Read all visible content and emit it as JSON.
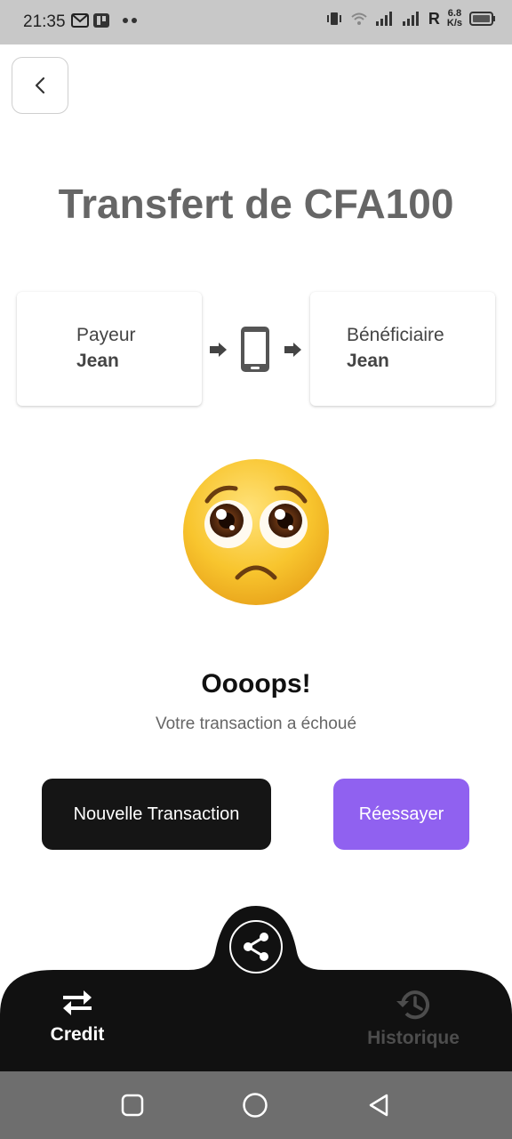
{
  "status_bar": {
    "time": "21:35",
    "network_speed_value": "6.8",
    "network_speed_unit": "K/s",
    "roaming_label": "R"
  },
  "page": {
    "title": "Transfert de CFA100"
  },
  "payer": {
    "role": "Payeur",
    "name": "Jean"
  },
  "beneficiary": {
    "role": "Bénéficiaire",
    "name": "Jean"
  },
  "result": {
    "heading": "Oooops!",
    "message": "Votre transaction a échoué"
  },
  "actions": {
    "new_transaction_label": "Nouvelle Transaction",
    "retry_label": "Réessayer"
  },
  "bottom_nav": {
    "credit_label": "Credit",
    "history_label": "Historique"
  },
  "colors": {
    "accent": "#9061f0",
    "dark": "#151515",
    "title_gray": "#666666"
  }
}
